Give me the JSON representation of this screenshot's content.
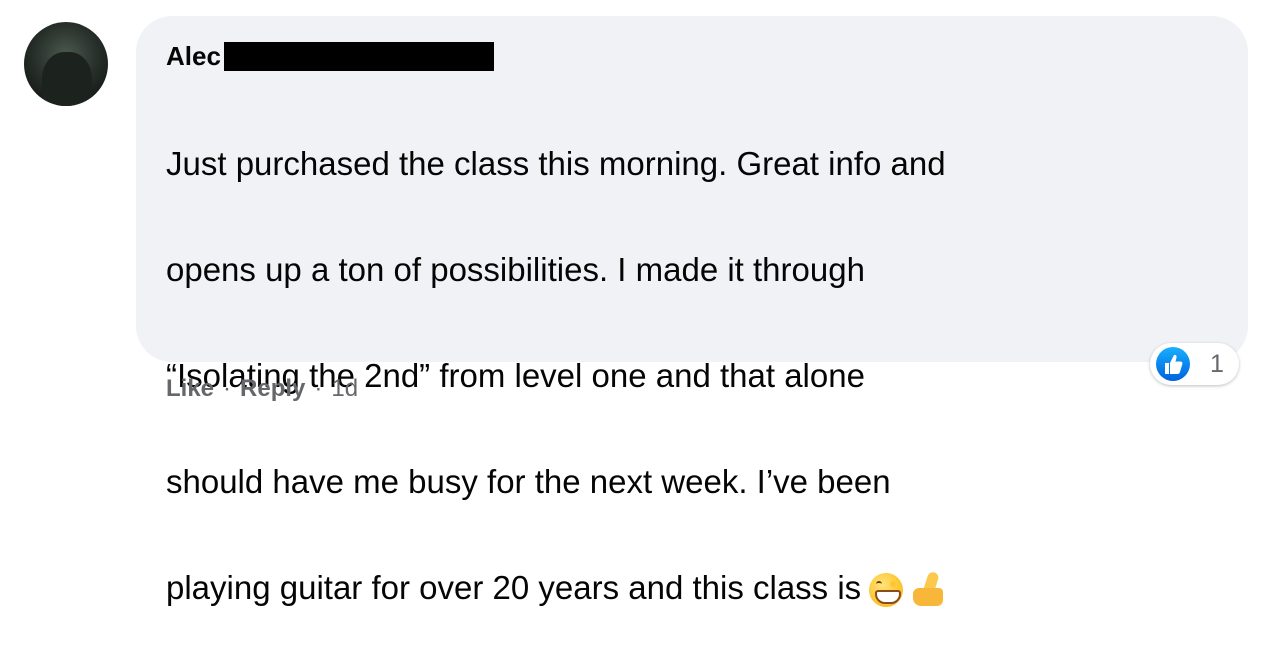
{
  "comment": {
    "author_name": "Alec",
    "text_lines": [
      "Just purchased the class this morning. Great info and",
      "opens up a ton of possibilities. I made it through",
      "“Isolating the 2nd” from level one and that alone",
      "should have me busy for the next week. I’ve been",
      "playing guitar for over 20 years and this class is"
    ],
    "emojis": [
      "grinning-face-emoji",
      "thumbs-up-emoji"
    ],
    "bubble_color": "#f0f2f5"
  },
  "actions": {
    "like_label": "Like",
    "separator": "·",
    "reply_label": "Reply",
    "timestamp": "1d"
  },
  "reactions": {
    "icon": "like-icon",
    "icon_color": "#1877f2",
    "count": "1"
  }
}
